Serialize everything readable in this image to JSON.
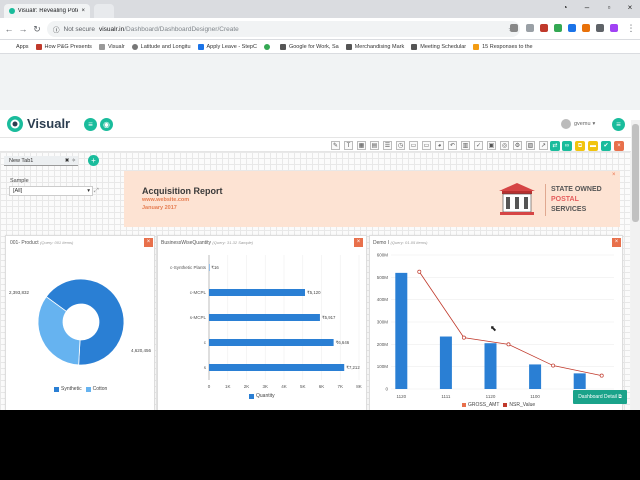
{
  "browser": {
    "tab_title": "Visualr: Revealing Potenti",
    "url_secure_label": "Not secure",
    "url_host": "visualr.in",
    "url_path": "/Dashboard/DashboardDesigner/Create",
    "bookmarks": [
      {
        "label": "Apps",
        "color": "#4285f4"
      },
      {
        "label": "How P&G Presents",
        "color": "#c0392b"
      },
      {
        "label": "Visualr",
        "color": "#999999"
      },
      {
        "label": "Latitude and Longitu",
        "color": "#777777"
      },
      {
        "label": "Apply Leave - StepC",
        "color": "#1a73e8"
      },
      {
        "label": "",
        "color": "#34a853"
      },
      {
        "label": "Google for Work, Sa",
        "color": "#555555"
      },
      {
        "label": "Merchandising Mark",
        "color": "#555555"
      },
      {
        "label": "Meeting Schedular",
        "color": "#555555"
      },
      {
        "label": "15 Responses to the",
        "color": "#f39c12"
      }
    ]
  },
  "app": {
    "brand": "Visualr",
    "user": "gvemu",
    "accent": "#1abc9c"
  },
  "tabs": {
    "active": "New Tab1"
  },
  "filter": {
    "label": "Sample",
    "value": "[All]"
  },
  "banner": {
    "title": "Acquisition Report",
    "url": "www.website.com",
    "date": "January 2017",
    "org_line1": "STATE OWNED",
    "org_line2": "POSTAL",
    "org_line3": "SERVICES"
  },
  "panels": {
    "product": {
      "title": "001- Product",
      "subtitle": "(Query: 001 Items)",
      "chart_data": {
        "type": "pie",
        "categories": [
          "Synthetic",
          "Cotton"
        ],
        "values": [
          4620456,
          2393832
        ],
        "data_labels": [
          "4,620,456",
          "2,393,832"
        ],
        "colors": [
          "#2a7fd4",
          "#66b3f0"
        ]
      }
    },
    "business": {
      "title": "BusinessWiseQuantity",
      "subtitle": "(Query: 31-32 Sample)",
      "chart_data": {
        "type": "bar",
        "orientation": "horizontal",
        "categories": [
          "c-Synthetic Plants",
          "c-MCPL",
          "s-MCPL",
          "c",
          "s"
        ],
        "values": [
          16,
          5120,
          5917,
          6646,
          7212
        ],
        "data_labels": [
          "₹16",
          "₹5,120",
          "₹5,917",
          "₹6,646",
          "₹7,212"
        ],
        "xticks": [
          "0",
          "1K",
          "2K",
          "3K",
          "4K",
          "5K",
          "6K",
          "7K",
          "8K"
        ],
        "xlim": [
          0,
          8000
        ],
        "legend": [
          "Quantity"
        ],
        "color": "#2a7fd4"
      }
    },
    "demo": {
      "title": "Demo I",
      "subtitle": "(Query: 01-05 Items)",
      "chart_data": {
        "type": "bar",
        "categories": [
          "1120",
          "1111",
          "1120",
          "1100",
          "1100"
        ],
        "series": [
          {
            "name": "GROSS_AMT",
            "type": "bar",
            "values": [
              520,
              235,
              205,
              110,
              70
            ],
            "color": "#2a7fd4"
          },
          {
            "name": "NSR_Value",
            "type": "line",
            "values": [
              525,
              230,
              200,
              105,
              60
            ],
            "color": "#c0392b"
          }
        ],
        "yticks": [
          "0",
          "100M",
          "200M",
          "300M",
          "400M",
          "500M",
          "600M"
        ],
        "ylim": [
          0,
          600
        ]
      }
    }
  },
  "footer": {
    "dashboard_detail": "Dashboard Detail"
  }
}
